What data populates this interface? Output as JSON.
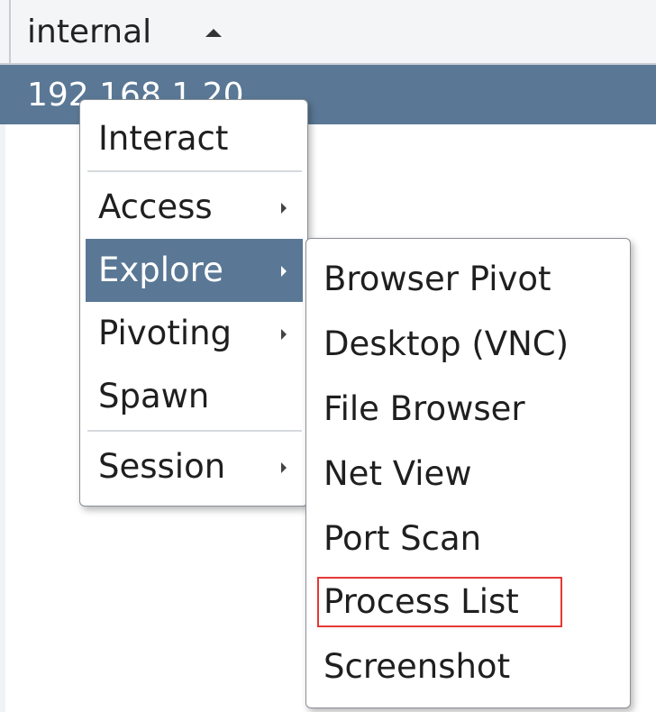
{
  "table": {
    "column_header": "internal",
    "sort_direction": "ascending",
    "selected_row": "192.168.1.20"
  },
  "context_menu": {
    "items": [
      {
        "label": "Interact",
        "submenu": false
      },
      {
        "label": "Access",
        "submenu": true
      },
      {
        "label": "Explore",
        "submenu": true,
        "active": true
      },
      {
        "label": "Pivoting",
        "submenu": true
      },
      {
        "label": "Spawn",
        "submenu": false
      },
      {
        "label": "Session",
        "submenu": true
      }
    ]
  },
  "explore_submenu": {
    "items": [
      {
        "label": "Browser Pivot"
      },
      {
        "label": "Desktop (VNC)"
      },
      {
        "label": "File Browser"
      },
      {
        "label": "Net View"
      },
      {
        "label": "Port Scan"
      },
      {
        "label": "Process List",
        "highlighted": true
      },
      {
        "label": "Screenshot"
      }
    ]
  },
  "colors": {
    "selection": "#5a7895",
    "highlight_border": "#e53935"
  }
}
